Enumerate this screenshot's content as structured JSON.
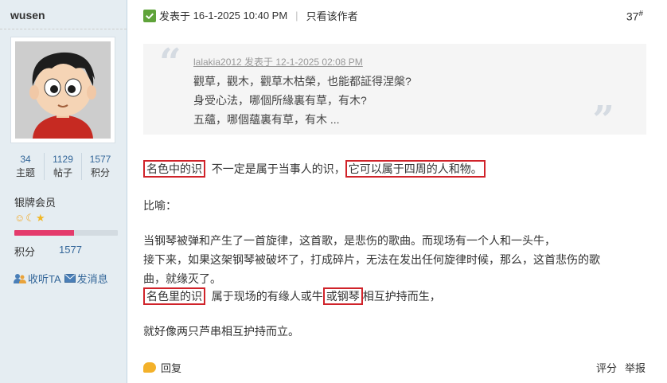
{
  "user": {
    "name": "wusen",
    "stats": [
      {
        "value": "34",
        "label": "主题"
      },
      {
        "value": "1129",
        "label": "帖子"
      },
      {
        "value": "1577",
        "label": "积分"
      }
    ],
    "rank": "银牌会员",
    "level_progress": 0.58,
    "points_label": "积分",
    "points_value": "1577",
    "follow_label": "收听TA",
    "message_label": "发消息",
    "medal_icons": [
      "sun-medal-icon",
      "moon-medal-icon",
      "star-medal-icon"
    ]
  },
  "post": {
    "posted_prefix": "发表于",
    "posted_time": "16-1-2025 10:40 PM",
    "only_author": "只看该作者",
    "floor_number": "37",
    "floor_symbol": "#",
    "quote": {
      "author_line": "lalakia2012 发表于 12-1-2025 02:08 PM",
      "lines": [
        "觀草，觀木，觀草木枯榮，也能都証得涅槃?",
        "身受心法，哪個所緣裏有草，有木?",
        "五蘊，哪個蘊裏有草，有木 ..."
      ]
    },
    "p1": {
      "hl1": "名色中的识",
      "mid": "不一定是属于当事人的识，",
      "hl2": "它可以属于四周的人和物。"
    },
    "p2": "比喻：",
    "p3_line1": "当钢琴被弹和产生了一首旋律，这首歌，是悲伤的歌曲。而现场有一个人和一头牛，",
    "p3_line2": "接下来，如果这架钢琴被破坏了，打成碎片，无法在发出任何旋律时候，那么，这首悲伤的歌",
    "p3_line3": "曲，就缘灭了。",
    "p4": {
      "hl1": "名色里的识",
      "mid": "属于现场的有缘人或牛",
      "hl2": "或钢琴",
      "end": "相互护持而生，"
    },
    "p5": "就好像两只芦串相互护持而立。",
    "reply_label": "回复",
    "rate_label": "评分",
    "report_label": "举报"
  },
  "colors": {
    "sidebar_bg": "#e5edf2",
    "link": "#336699",
    "highlight_border": "#d0232a",
    "level_bar": "#e43b6c"
  }
}
